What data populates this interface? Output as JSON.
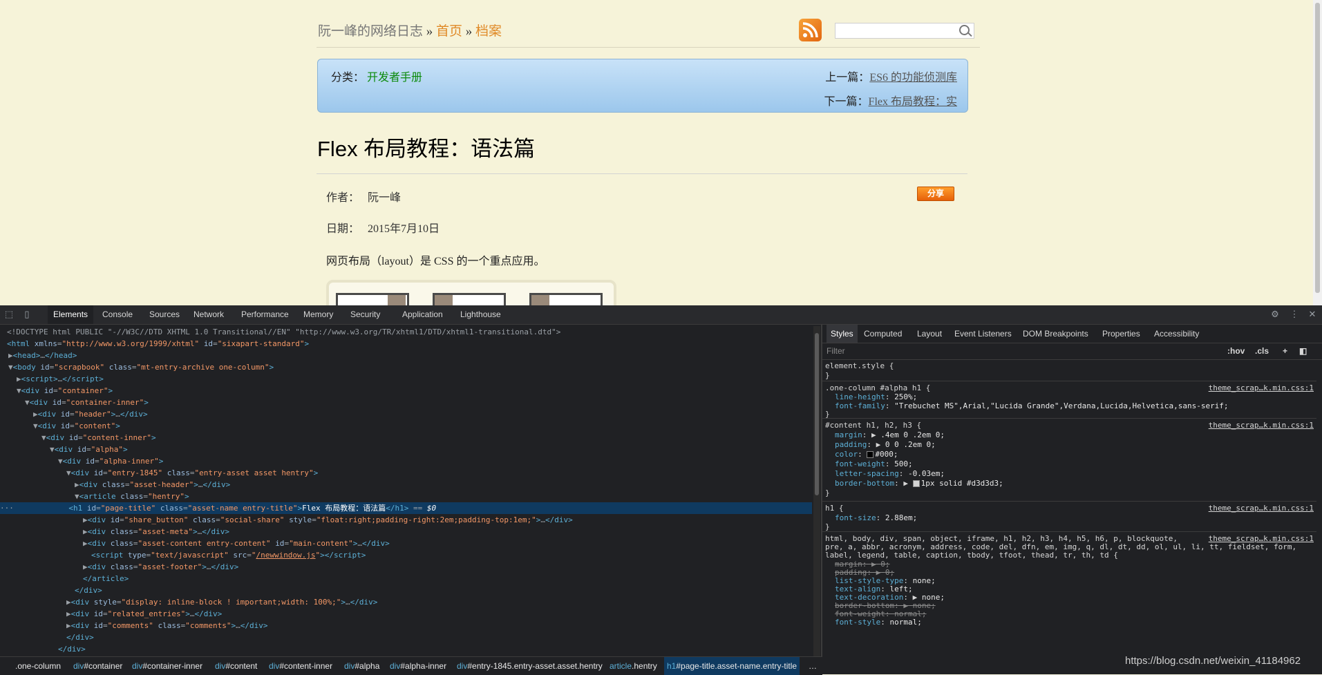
{
  "page": {
    "blog_name": "阮一峰的网络日志",
    "separator": "»",
    "nav_home": "首页",
    "nav_archive": "档案",
    "category_label": "分类：",
    "category_value": "开发者手册",
    "prev_label": "上一篇：",
    "prev_title": "ES6 的功能侦测库",
    "next_label": "下一篇：",
    "next_title": "Flex 布局教程：实",
    "title": "Flex 布局教程：语法篇",
    "author_label": "作者：",
    "author": "阮一峰",
    "date_label": "日期：",
    "date": "2015年7月10日",
    "share_button": "分享",
    "lead": "网页布局（layout）是 CSS 的一个重点应用。"
  },
  "devtools": {
    "tabs": [
      "Elements",
      "Console",
      "Sources",
      "Network",
      "Performance",
      "Memory",
      "Security",
      "Application",
      "Lighthouse"
    ],
    "active_tab": "Elements",
    "styles_tabs": [
      "Styles",
      "Computed",
      "Layout",
      "Event Listeners",
      "DOM Breakpoints",
      "Properties",
      "Accessibility"
    ],
    "filter_placeholder": "Filter",
    "hov": ":hov",
    "cls": ".cls",
    "add": "+",
    "breadcrumbs": [
      {
        "t": "",
        "i": ".one-column"
      },
      {
        "t": "div",
        "i": "#container"
      },
      {
        "t": "div",
        "i": "#container-inner"
      },
      {
        "t": "div",
        "i": "#content"
      },
      {
        "t": "div",
        "i": "#content-inner"
      },
      {
        "t": "div",
        "i": "#alpha"
      },
      {
        "t": "div",
        "i": "#alpha-inner"
      },
      {
        "t": "div",
        "i": "#entry-1845.entry-asset.asset.hentry"
      },
      {
        "t": "article",
        "i": ".hentry"
      },
      {
        "t": "h1",
        "i": "#page-title.asset-name.entry-title"
      }
    ],
    "breadcrumbs_more": "…",
    "styles": {
      "element_style": "element.style {",
      "close": "}",
      "source": "theme_scrap…k.min.css:1",
      "r1_sel": ".one-column #alpha h1 {",
      "r1_p1": "line-height",
      "r1_v1": "250%;",
      "r1_p2": "font-family",
      "r1_v2": "\"Trebuchet MS\",Arial,\"Lucida Grande\",Verdana,Lucida,Helvetica,sans-serif;",
      "r2_sel": "#content h1, h2, h3 {",
      "r2_p1": "margin",
      "r2_v1": ".4em 0 .2em 0;",
      "r2_p2": "padding",
      "r2_v2": "0 0 .2em 0;",
      "r2_p3": "color",
      "r2_v3": "#000;",
      "r2_p4": "font-weight",
      "r2_v4": "500;",
      "r2_p5": "letter-spacing",
      "r2_v5": "-0.03em;",
      "r2_p6": "border-bottom",
      "r2_v6": "1px solid #d3d3d3;",
      "r3_sel": "h1 {",
      "r3_p1": "font-size",
      "r3_v1": "2.88em;",
      "r4_sel1": "html, body, div, span, object, iframe, h1, h2, h3, h4, h5, h6, p, blockquote,",
      "r4_sel2": "pre, a, abbr, acronym, address, code, del, dfn, em, img, q, dl, dt, dd, ol, ul, li, tt, fieldset, form,",
      "r4_sel3": "label, legend, table, caption, tbody, tfoot, thead, tr, th, td {",
      "r4_p1": "margin",
      "r4_v1": "0;",
      "r4_p2": "padding",
      "r4_v2": "0;",
      "r4_p3": "list-style-type",
      "r4_v3": "none;",
      "r4_p4": "text-align",
      "r4_v4": "left;",
      "r4_p5": "text-decoration",
      "r4_v5": "none;",
      "r4_p6": "border-bottom",
      "r4_v6": "none;",
      "r4_p7": "font-weight",
      "r4_v7": "normal;",
      "r4_p8": "font-style",
      "r4_v8": "normal;"
    }
  },
  "watermark": "https://blog.csdn.net/weixin_41184962",
  "colors": {
    "page_bg": "#f6f3d9",
    "link_orange": "#e08a28",
    "category_green": "#0b8a0b",
    "devtools_bg": "#202124",
    "selection": "#0f3a60"
  }
}
